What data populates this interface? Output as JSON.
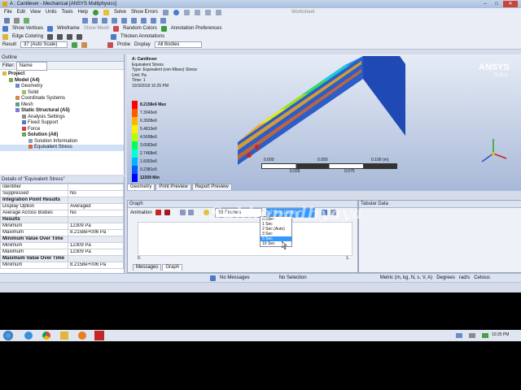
{
  "window": {
    "title": "A : Cantilever - Mechanical [ANSYS Multiphysics]"
  },
  "menu": [
    "File",
    "Edit",
    "View",
    "Units",
    "Tools",
    "Help"
  ],
  "toolbar1": {
    "solve": "Solve",
    "show_errors": "Show Errors",
    "worksheet": "Worksheet"
  },
  "toolbar2": {
    "show_vertices": "Show Vertices",
    "wireframe": "Wireframe",
    "show_mesh": "Show Mesh",
    "random_colors": "Random Colors",
    "annotation_prefs": "Annotation Preferences"
  },
  "toolbar3": {
    "edge_coloring": "Edge Coloring",
    "thicken": "Thicken Annotations"
  },
  "toolbar4": {
    "result_label": "Result",
    "result_value": "37 (Auto Scale)",
    "probe": "Probe",
    "display_label": "Display",
    "display_value": "All Bodies"
  },
  "outline": {
    "title": "Outline",
    "filter_label": "Filter:",
    "filter_value": "Name",
    "items": [
      {
        "label": "Project",
        "level": 0,
        "color": "#d9b84a",
        "bold": true
      },
      {
        "label": "Model (A4)",
        "level": 1,
        "color": "#7aa84d",
        "bold": true
      },
      {
        "label": "Geometry",
        "level": 2,
        "color": "#6b8cc9",
        "bold": false
      },
      {
        "label": "Solid",
        "level": 3,
        "color": "#9fbf6a",
        "bold": false
      },
      {
        "label": "Coordinate Systems",
        "level": 2,
        "color": "#cc8d4d",
        "bold": false
      },
      {
        "label": "Mesh",
        "level": 2,
        "color": "#5aa08e",
        "bold": false
      },
      {
        "label": "Static Structural (A5)",
        "level": 2,
        "color": "#7c7fc9",
        "bold": true
      },
      {
        "label": "Analysis Settings",
        "level": 3,
        "color": "#8c8c8c",
        "bold": false
      },
      {
        "label": "Fixed Support",
        "level": 3,
        "color": "#5577bb",
        "bold": false
      },
      {
        "label": "Force",
        "level": 3,
        "color": "#cc4444",
        "bold": false
      },
      {
        "label": "Solution (A6)",
        "level": 3,
        "color": "#6aa35a",
        "bold": true
      },
      {
        "label": "Solution Information",
        "level": 4,
        "color": "#8aa0c8",
        "bold": false
      },
      {
        "label": "Equivalent Stress",
        "level": 4,
        "color": "#d06a3a",
        "bold": false
      }
    ]
  },
  "details": {
    "title": "Details of \"Equivalent Stress\"",
    "rows": [
      {
        "k": "Identifier",
        "v": "",
        "group": false
      },
      {
        "k": "Suppressed",
        "v": "No",
        "group": false
      },
      {
        "k": "Integration Point Results",
        "v": "",
        "group": true
      },
      {
        "k": "Display Option",
        "v": "Averaged",
        "group": false
      },
      {
        "k": "Average Across Bodies",
        "v": "No",
        "group": false
      },
      {
        "k": "Results",
        "v": "",
        "group": true
      },
      {
        "k": "Minimum",
        "v": "12309 Pa",
        "group": false
      },
      {
        "k": "Maximum",
        "v": "8.2158e+006 Pa",
        "group": false
      },
      {
        "k": "Minimum Value Over Time",
        "v": "",
        "group": true
      },
      {
        "k": "Minimum",
        "v": "12309 Pa",
        "group": false
      },
      {
        "k": "Maximum",
        "v": "12309 Pa",
        "group": false
      },
      {
        "k": "Maximum Value Over Time",
        "v": "",
        "group": true
      },
      {
        "k": "Minimum",
        "v": "8.2158e+006 Pa",
        "group": false
      }
    ]
  },
  "viewport": {
    "header": [
      "A: Cantilever",
      "Equivalent Stress",
      "Type: Equivalent (von-Mises) Stress",
      "Unit: Pa",
      "Time: 1",
      "10/3/2018 10:25 PM"
    ],
    "logo": "ANSYS",
    "version": "R15.0",
    "legend_max": "8.2158e6 Max",
    "legend_min": "12309 Min",
    "legend_values": [
      "7.3043e6",
      "6.3928e6",
      "5.4813e6",
      "4.5698e6",
      "3.6583e6",
      "2.7468e6",
      "1.8353e6",
      "9.2381e5"
    ],
    "legend_colors": [
      "#ff0000",
      "#ff5a00",
      "#ffb400",
      "#fff000",
      "#b4ff00",
      "#00ff5a",
      "#00ffd2",
      "#00b4ff",
      "#005aff",
      "#0000ff"
    ],
    "scale_top": [
      "0.000",
      "0.050",
      "0.100 (m)"
    ],
    "scale_bottom": [
      "0.025",
      "0.075"
    ],
    "tabs": [
      "Geometry",
      "Print Preview",
      "Report Preview"
    ]
  },
  "graph": {
    "title": "Graph",
    "animation": "Animation",
    "frames": "10 Frames",
    "duration_selected": "2 Sec (Auto)",
    "duration_options": [
      "0.5Sec",
      "1 Sec",
      "2 Sec (Auto)",
      "3 Sec",
      "5 Sec",
      "10 Sec"
    ],
    "duration_highlighted_index": 4,
    "axis_left": "0.",
    "axis_right": "1.",
    "bottom_tabs": [
      "Messages",
      "Graph"
    ]
  },
  "tabular": {
    "title": "Tabular Data"
  },
  "watermark": "Sukhopadhyaya",
  "status": {
    "messages": "No Messages",
    "selection": "No Selection",
    "units": "Metric (m, kg, N, s, V, A)",
    "angle": "Degrees",
    "rate": "rad/s",
    "temp": "Celsius"
  },
  "taskbar": {
    "time": "10:25 PM"
  }
}
